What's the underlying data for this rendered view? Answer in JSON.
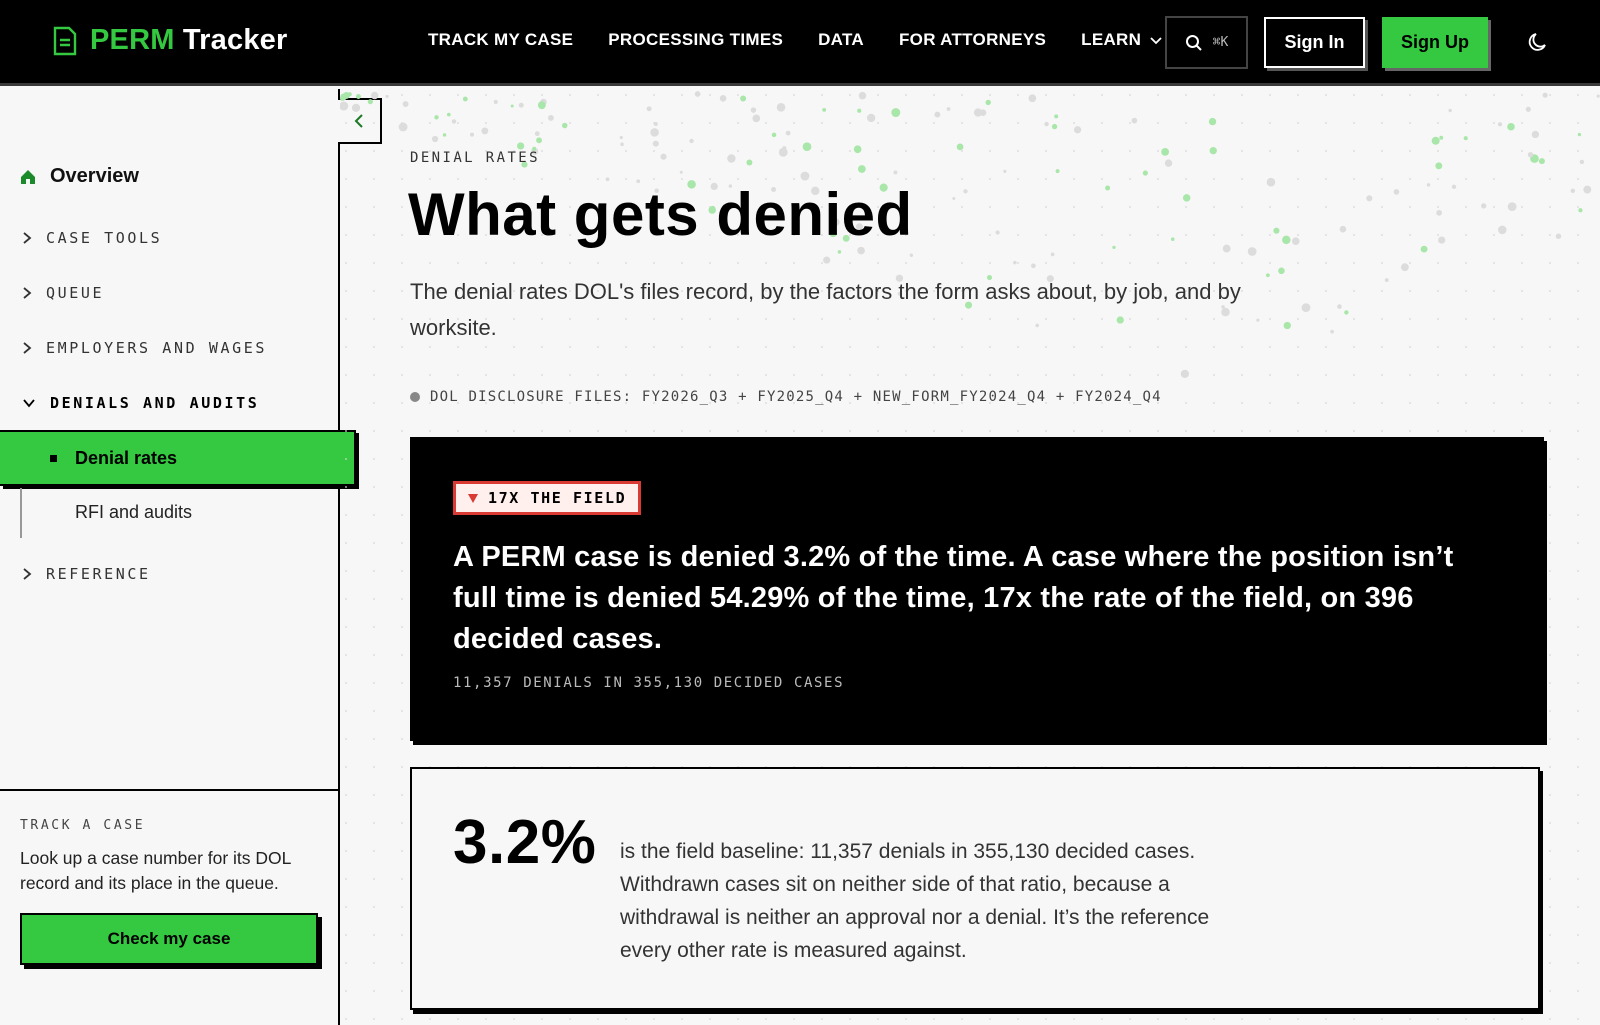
{
  "brand": {
    "accent": "PERM",
    "rest": "Tracker"
  },
  "nav": {
    "items": [
      {
        "label": "TRACK MY CASE"
      },
      {
        "label": "PROCESSING TIMES"
      },
      {
        "label": "DATA"
      },
      {
        "label": "FOR ATTORNEYS"
      },
      {
        "label": "LEARN"
      }
    ],
    "search_shortcut": "⌘K",
    "sign_in": "Sign In",
    "sign_up": "Sign Up"
  },
  "sidebar": {
    "overview": "Overview",
    "sections": [
      {
        "label": "CASE TOOLS"
      },
      {
        "label": "QUEUE"
      },
      {
        "label": "EMPLOYERS AND WAGES"
      },
      {
        "label": "DENIALS AND AUDITS"
      },
      {
        "label": "REFERENCE"
      }
    ],
    "active_item": "Denial rates",
    "sub_item": "RFI and audits",
    "track": {
      "label": "TRACK A CASE",
      "description": "Look up a case number for its DOL record and its place in the queue.",
      "button": "Check my case"
    }
  },
  "main": {
    "eyebrow": "DENIAL RATES",
    "title": "What gets denied",
    "lede": "The denial rates DOL's files record, by the factors the form asks about, by job, and by worksite.",
    "sources": "DOL DISCLOSURE FILES: FY2026_Q3 + FY2025_Q4 + NEW_FORM_FY2024_Q4 + FY2024_Q4",
    "callout": {
      "tag": "17X THE FIELD",
      "text": "A PERM case is denied 3.2% of the time. A case where the position isn’t full time is denied 54.29% of the time, 17x the rate of the field, on 396 decided cases.",
      "footnote": "11,357 DENIALS IN 355,130 DECIDED CASES"
    },
    "stat": {
      "value": "3.2%",
      "text": "is the field baseline: 11,357 denials in 355,130 decided cases. Withdrawn cases sit on neither side of that ratio, because a withdrawal is neither an approval nor a denial. It’s the reference every other rate is measured against."
    }
  },
  "colors": {
    "accent": "#34c940",
    "alert": "#d93a33",
    "ink": "#000000",
    "paper": "#f7f7f7"
  }
}
